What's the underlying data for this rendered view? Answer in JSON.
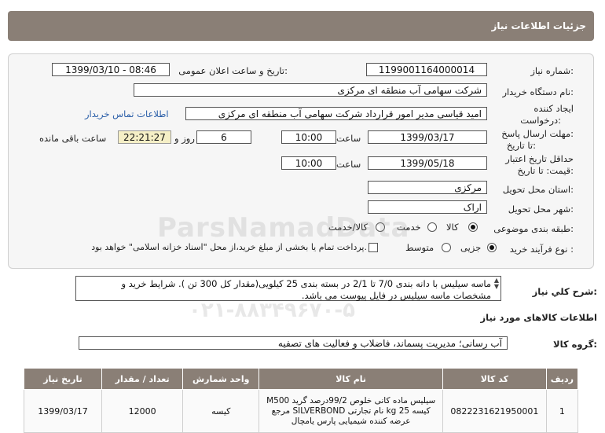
{
  "header": {
    "title": "جزئیات اطلاعات نیاز"
  },
  "fields": {
    "need_number_label": "شماره نیاز:",
    "need_number": "1199001164000014",
    "announce_label": "تاریخ و ساعت اعلان عمومی:",
    "announce_value": "1399/03/10 - 08:46",
    "buyer_label": "نام دستگاه خریدار:",
    "buyer_value": "شرکت سهامی آب منطقه ای مرکزی",
    "creator_label_1": "ایجاد کننده",
    "creator_label_2": "درخواست:",
    "creator_value": "امید قیاسی مدیر امور قرارداد شرکت سهامی آب منطقه ای مرکزی",
    "contact_link": "اطلاعات تماس خریدار",
    "deadline_label_1": "مهلت ارسال پاسخ:",
    "deadline_label_2": "تا تاریخ:",
    "deadline_date": "1399/03/17",
    "time_label": "ساعت",
    "deadline_time": "10:00",
    "days_value": "6",
    "days_label": "روز و",
    "remaining_time": "22:21:27",
    "remaining_label": "ساعت باقی مانده",
    "validity_label_1": "حداقل تاریخ اعتبار",
    "validity_label_2": "قیمت: تا تاریخ:",
    "validity_date": "1399/05/18",
    "validity_time": "10:00",
    "province_label": "استان محل تحویل:",
    "province_value": "مرکزی",
    "city_label": "شهر محل تحویل:",
    "city_value": "اراک",
    "category_label": "طبقه بندی موضوعی:",
    "category_options": [
      "کالا",
      "خدمت",
      "کالا/خدمت"
    ],
    "purchase_label": "نوع فرآیند خرید :",
    "purchase_options": [
      "جزیی",
      "متوسط"
    ],
    "payment_note": "پرداخت تمام یا بخشی از مبلغ خرید،از محل \"اسناد خزانه اسلامی\" خواهد بود."
  },
  "description": {
    "label": "شرح کلي نياز:",
    "text": "ماسه سیلیس با دانه بندی 7/0 تا 2/1 در بسته بندی 25 کیلویی(مقدار کل 300 تن ).  شرایط خرید و مشخصات ماسه سیلیس در فایل پیوست می باشد."
  },
  "goods_section": {
    "title": "اطلاعات کالاهای مورد نیاز",
    "group_label": "گروه کالا:",
    "group_value": "آب رسانی؛ مدیریت پسماند، فاضلاب و فعالیت های تصفیه"
  },
  "table": {
    "headers": [
      "ردیف",
      "کد کالا",
      "نام کالا",
      "واحد شمارش",
      "تعداد / مقدار",
      "تاریخ نیاز"
    ],
    "rows": [
      {
        "row": "1",
        "code": "0822231621950001",
        "name": "سیلیس ماده کانی خلوص 99/2درصد گرید M500 کیسه 25 kg نام تجارتی SILVERBOND مرجع عرضه کننده شیمیایی پارس یامچال",
        "unit": "کیسه",
        "qty": "12000",
        "date": "1399/03/17"
      }
    ]
  },
  "watermark": {
    "line1": "ParsNamadData",
    "line2": "۰۲۱-۸۸۳۴۹۶۷۰-۵"
  }
}
